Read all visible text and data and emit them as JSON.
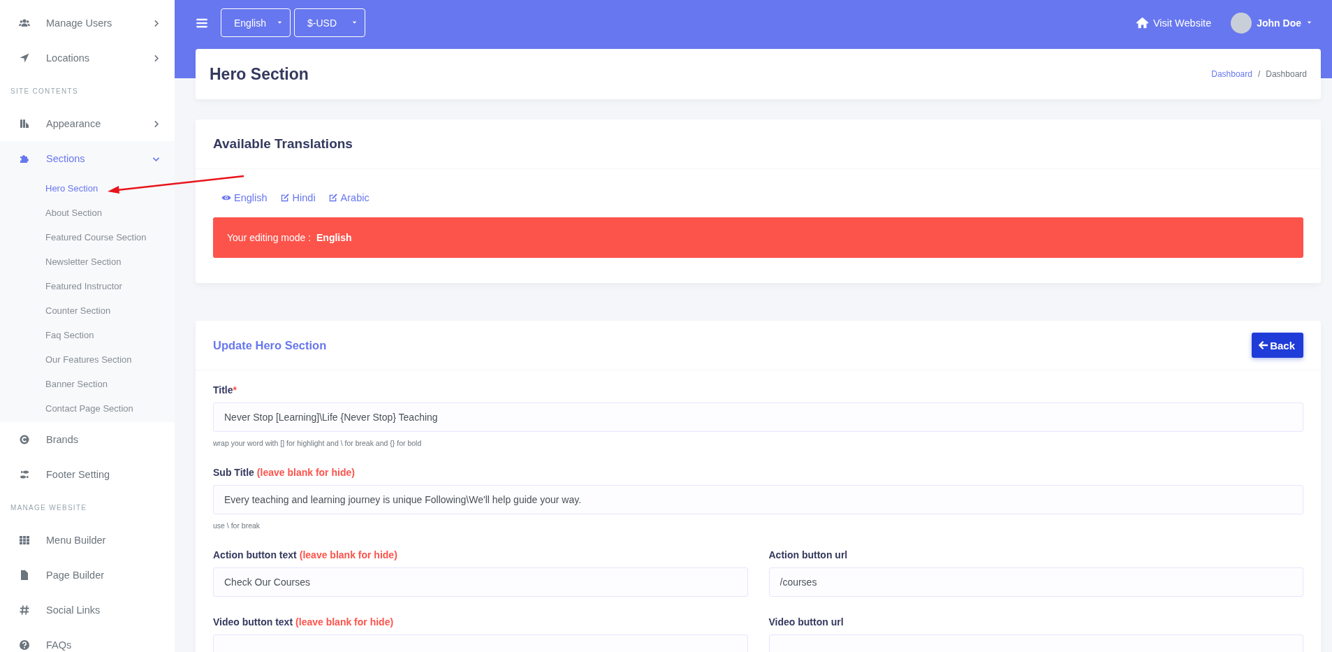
{
  "sidebar": {
    "items": [
      {
        "kind": "link",
        "label": "Manage Users",
        "selected": false,
        "expanded": false
      },
      {
        "kind": "link",
        "label": "Locations",
        "selected": false,
        "expanded": false
      },
      {
        "kind": "heading",
        "label": "SITE CONTENTS"
      },
      {
        "kind": "link",
        "label": "Appearance",
        "selected": false,
        "expanded": false
      },
      {
        "kind": "link",
        "label": "Sections",
        "selected": true,
        "expanded": true,
        "children": [
          {
            "label": "Hero Section",
            "selected": true
          },
          {
            "label": "About Section",
            "selected": false
          },
          {
            "label": "Featured Course Section",
            "selected": false
          },
          {
            "label": "Newsletter Section",
            "selected": false
          },
          {
            "label": "Featured Instructor",
            "selected": false
          },
          {
            "label": "Counter Section",
            "selected": false
          },
          {
            "label": "Faq Section",
            "selected": false
          },
          {
            "label": "Our Features Section",
            "selected": false
          },
          {
            "label": "Banner Section",
            "selected": false
          },
          {
            "label": "Contact Page Section",
            "selected": false
          }
        ]
      },
      {
        "kind": "link",
        "label": "Brands",
        "selected": false
      },
      {
        "kind": "link",
        "label": "Footer Setting",
        "selected": false
      },
      {
        "kind": "heading",
        "label": "MANAGE WEBSITE"
      },
      {
        "kind": "link",
        "label": "Menu Builder",
        "selected": false
      },
      {
        "kind": "link",
        "label": "Page Builder",
        "selected": false
      },
      {
        "kind": "link",
        "label": "Social Links",
        "selected": false
      },
      {
        "kind": "link",
        "label": "FAQs",
        "selected": false
      }
    ]
  },
  "topbar": {
    "selects": [
      "English",
      "$-USD"
    ],
    "visit_website": "Visit Website",
    "user": "John Doe"
  },
  "page_header": {
    "title": "Hero Section",
    "separator": "/",
    "breadcrumb": [
      {
        "label": "Dashboard",
        "link": true
      },
      {
        "label": "Dashboard",
        "link": false
      }
    ]
  },
  "translations": {
    "title": "Available Translations",
    "languages": [
      {
        "label": "English",
        "selected": true
      },
      {
        "label": "Hindi",
        "selected": false
      },
      {
        "label": "Arabic",
        "selected": false
      }
    ],
    "alert": "Your editing mode : **English**"
  },
  "form": {
    "title": "Update Hero Section",
    "back_button": "Back",
    "rows": [
      [
        {
          "label": "Title",
          "note": "*",
          "required": true,
          "value": "Never Stop [Learning]\\Life {Never Stop} Teaching",
          "help": "wrap your word with [] for highlight and \\ for break and {} for bold"
        }
      ],
      [
        {
          "label": "Sub Title",
          "note": "(leave blank for hide)",
          "value": "Every teaching and learning journey is unique Following\\We'll help guide your way.",
          "help": "use \\ for break"
        }
      ],
      [
        {
          "label": "Action button text",
          "note": "(leave blank for hide)",
          "value": "Check Our Courses"
        },
        {
          "label": "Action button url",
          "value": "/courses"
        }
      ],
      [
        {
          "label": "Video button text",
          "note": "(leave blank for hide)"
        },
        {
          "label": "Video button url"
        }
      ]
    ]
  }
}
